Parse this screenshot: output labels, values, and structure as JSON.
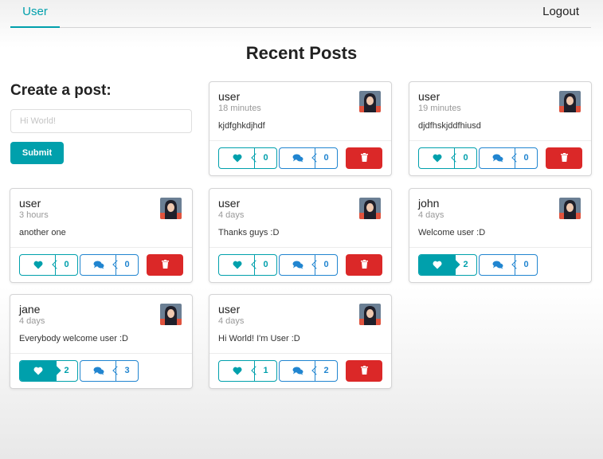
{
  "nav": {
    "user_tab": "User",
    "logout": "Logout"
  },
  "page": {
    "title": "Recent Posts"
  },
  "create": {
    "title": "Create a post:",
    "placeholder": "Hi World!",
    "submit": "Submit"
  },
  "colors": {
    "teal": "#00a0ac",
    "blue": "#2185d0",
    "red": "#db2828"
  },
  "posts": [
    {
      "author": "user",
      "time": "18 minutes",
      "text": "kjdfghkdjhdf",
      "likes": "0",
      "comments": "0",
      "liked": false,
      "deletable": true
    },
    {
      "author": "user",
      "time": "19 minutes",
      "text": "djdfhskjddfhiusd",
      "likes": "0",
      "comments": "0",
      "liked": false,
      "deletable": true
    },
    {
      "author": "user",
      "time": "3 hours",
      "text": "another one",
      "likes": "0",
      "comments": "0",
      "liked": false,
      "deletable": true
    },
    {
      "author": "user",
      "time": "4 days",
      "text": "Thanks guys :D",
      "likes": "0",
      "comments": "0",
      "liked": false,
      "deletable": true
    },
    {
      "author": "john",
      "time": "4 days",
      "text": "Welcome user :D",
      "likes": "2",
      "comments": "0",
      "liked": true,
      "deletable": false
    },
    {
      "author": "jane",
      "time": "4 days",
      "text": "Everybody welcome user :D",
      "likes": "2",
      "comments": "3",
      "liked": true,
      "deletable": false
    },
    {
      "author": "user",
      "time": "4 days",
      "text": "Hi World! I'm User :D",
      "likes": "1",
      "comments": "2",
      "liked": false,
      "deletable": true
    }
  ]
}
